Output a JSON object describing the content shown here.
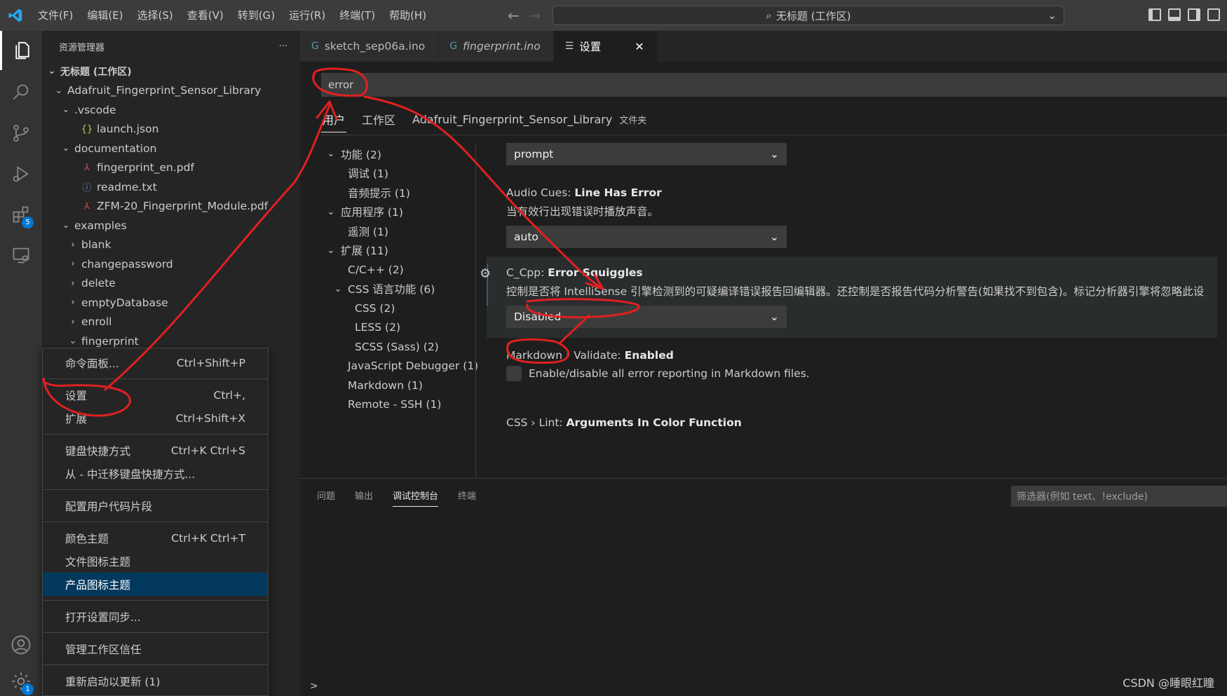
{
  "titlebar": {
    "menu": [
      "文件(F)",
      "编辑(E)",
      "选择(S)",
      "查看(V)",
      "转到(G)",
      "运行(R)",
      "终端(T)",
      "帮助(H)"
    ],
    "search": "无标题 (工作区)"
  },
  "sidebar": {
    "title": "资源管理器",
    "more": "···",
    "tree": [
      {
        "label": "无标题 (工作区)",
        "indent": 0,
        "chev": "open",
        "icon": "",
        "bold": true
      },
      {
        "label": "Adafruit_Fingerprint_Sensor_Library",
        "indent": 1,
        "chev": "open",
        "icon": ""
      },
      {
        "label": ".vscode",
        "indent": 2,
        "chev": "open",
        "icon": ""
      },
      {
        "label": "launch.json",
        "indent": 3,
        "chev": "",
        "icon": "json"
      },
      {
        "label": "documentation",
        "indent": 2,
        "chev": "open",
        "icon": ""
      },
      {
        "label": "fingerprint_en.pdf",
        "indent": 3,
        "chev": "",
        "icon": "pdf"
      },
      {
        "label": "readme.txt",
        "indent": 3,
        "chev": "",
        "icon": "info"
      },
      {
        "label": "ZFM-20_Fingerprint_Module.pdf",
        "indent": 3,
        "chev": "",
        "icon": "pdf"
      },
      {
        "label": "examples",
        "indent": 2,
        "chev": "open",
        "icon": ""
      },
      {
        "label": "blank",
        "indent": 3,
        "chev": "closed",
        "icon": ""
      },
      {
        "label": "changepassword",
        "indent": 3,
        "chev": "closed",
        "icon": ""
      },
      {
        "label": "delete",
        "indent": 3,
        "chev": "closed",
        "icon": ""
      },
      {
        "label": "emptyDatabase",
        "indent": 3,
        "chev": "closed",
        "icon": ""
      },
      {
        "label": "enroll",
        "indent": 3,
        "chev": "closed",
        "icon": ""
      },
      {
        "label": "fingerprint",
        "indent": 3,
        "chev": "open",
        "icon": ""
      }
    ]
  },
  "activity": {
    "extensions_badge": "5",
    "manage_badge": "1"
  },
  "context_menu": [
    {
      "label": "命令面板...",
      "shortcut": "Ctrl+Shift+P"
    },
    "sep",
    {
      "label": "设置",
      "shortcut": "Ctrl+,"
    },
    {
      "label": "扩展",
      "shortcut": "Ctrl+Shift+X"
    },
    "sep",
    {
      "label": "键盘快捷方式",
      "shortcut": "Ctrl+K Ctrl+S"
    },
    {
      "label": "从 - 中迁移键盘快捷方式...",
      "shortcut": ""
    },
    "sep",
    {
      "label": "配置用户代码片段",
      "shortcut": ""
    },
    "sep",
    {
      "label": "颜色主题",
      "shortcut": "Ctrl+K Ctrl+T"
    },
    {
      "label": "文件图标主题",
      "shortcut": ""
    },
    {
      "label": "产品图标主题",
      "shortcut": "",
      "selected": true
    },
    "sep",
    {
      "label": "打开设置同步...",
      "shortcut": ""
    },
    "sep",
    {
      "label": "管理工作区信任",
      "shortcut": ""
    },
    "sep",
    {
      "label": "重新启动以更新 (1)",
      "shortcut": ""
    }
  ],
  "tabs": [
    {
      "label": "sketch_sep06a.ino",
      "icon": "arduino",
      "active": false,
      "italic": false
    },
    {
      "label": "fingerprint.ino",
      "icon": "arduino",
      "active": false,
      "italic": true
    },
    {
      "label": "设置",
      "icon": "settings",
      "active": true,
      "italic": false,
      "close": "✕"
    }
  ],
  "settings": {
    "search_value": "error",
    "scopes": {
      "user": "用户",
      "workspace": "工作区",
      "folder": "Adafruit_Fingerprint_Sensor_Library",
      "folder_suffix": "文件夹"
    },
    "toc": [
      {
        "label": "功能 (2)",
        "indent": 0,
        "chev": "open"
      },
      {
        "label": "调试 (1)",
        "indent": 1,
        "chev": ""
      },
      {
        "label": "音频提示 (1)",
        "indent": 1,
        "chev": ""
      },
      {
        "label": "应用程序 (1)",
        "indent": 0,
        "chev": "open"
      },
      {
        "label": "遥测 (1)",
        "indent": 1,
        "chev": ""
      },
      {
        "label": "扩展 (11)",
        "indent": 0,
        "chev": "open"
      },
      {
        "label": "C/C++ (2)",
        "indent": 1,
        "chev": ""
      },
      {
        "label": "CSS 语言功能 (6)",
        "indent": 1,
        "chev": "open"
      },
      {
        "label": "CSS (2)",
        "indent": 2,
        "chev": ""
      },
      {
        "label": "LESS (2)",
        "indent": 2,
        "chev": ""
      },
      {
        "label": "SCSS (Sass) (2)",
        "indent": 2,
        "chev": ""
      },
      {
        "label": "JavaScript Debugger (1)",
        "indent": 1,
        "chev": ""
      },
      {
        "label": "Markdown (1)",
        "indent": 1,
        "chev": ""
      },
      {
        "label": "Remote - SSH (1)",
        "indent": 1,
        "chev": ""
      }
    ],
    "items": {
      "prev_select": "prompt",
      "audio": {
        "cat": "Audio Cues: ",
        "name": "Line Has Error",
        "desc": "当有效行出现错误时播放声音。",
        "value": "auto"
      },
      "squiggles": {
        "cat": "C_Cpp: ",
        "name": "Error Squiggles",
        "desc": "控制是否将 IntelliSense 引擎检测到的可疑编译错误报告回编辑器。还控制是否报告代码分析警告(如果找不到包含)。标记分析器引擎将忽略此设",
        "value": "Disabled"
      },
      "markdown": {
        "cat": "Markdown › Validate: ",
        "name": "Enabled",
        "desc": "Enable/disable all error reporting in Markdown files."
      },
      "css": {
        "cat": "CSS › Lint: ",
        "name": "Arguments In Color Function"
      }
    }
  },
  "panel": {
    "tabs": [
      "问题",
      "输出",
      "调试控制台",
      "终端"
    ],
    "active_tab": "调试控制台",
    "filter_placeholder": "筛选器(例如 text、!exclude)",
    "prompt": ">"
  },
  "watermark": "CSDN @睡眼红瞳",
  "colors": {
    "accent": "#007acc",
    "annotation": "#e02020",
    "selection": "#04395e"
  }
}
